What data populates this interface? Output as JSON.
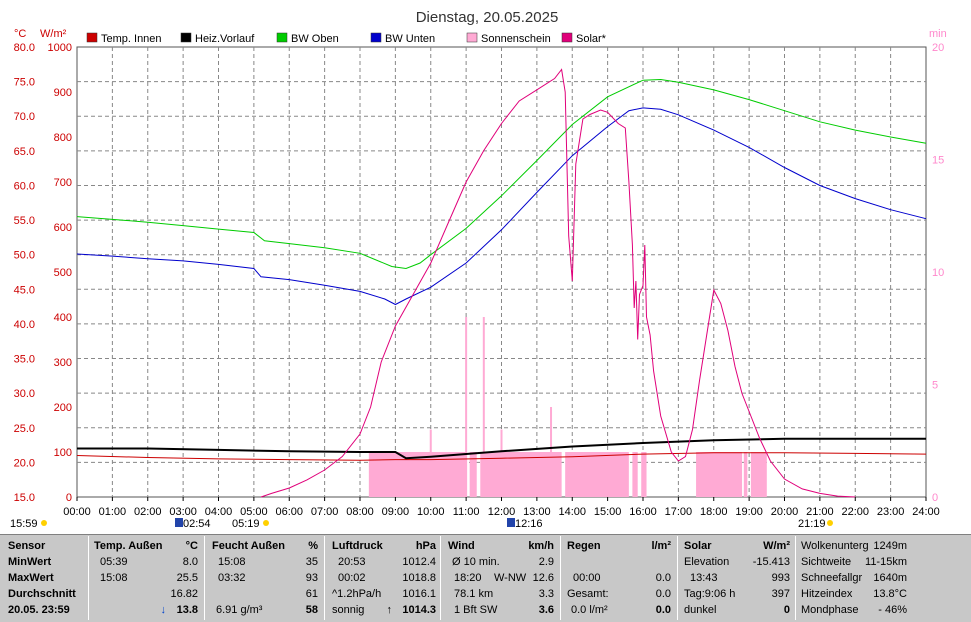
{
  "chart_data": {
    "type": "line",
    "title": "Dienstag, 20.05.2025",
    "axes": {
      "left1": {
        "unit": "°C",
        "min": 15,
        "max": 80,
        "ticks": [
          "80.0",
          "75.0",
          "70.0",
          "65.0",
          "60.0",
          "55.0",
          "50.0",
          "45.0",
          "40.0",
          "35.0",
          "30.0",
          "25.0",
          "20.0",
          "15.0"
        ],
        "color": "#cc0000"
      },
      "left2": {
        "unit": "W/m²",
        "min": 0,
        "max": 1000,
        "ticks": [
          "1000",
          "900",
          "800",
          "700",
          "600",
          "500",
          "400",
          "300",
          "200",
          "100",
          "0"
        ],
        "color": "#cc0000"
      },
      "right": {
        "unit": "min",
        "min": 0,
        "max": 20,
        "ticks": [
          "20",
          "15",
          "10",
          "5",
          "0"
        ],
        "color": "#ff88cc"
      },
      "x": {
        "ticks": [
          "00:00",
          "01:00",
          "02:00",
          "03:00",
          "04:00",
          "05:00",
          "06:00",
          "07:00",
          "08:00",
          "09:00",
          "10:00",
          "11:00",
          "12:00",
          "13:00",
          "14:00",
          "15:00",
          "16:00",
          "17:00",
          "18:00",
          "19:00",
          "20:00",
          "21:00",
          "22:00",
          "23:00",
          "24:00"
        ]
      }
    },
    "legend": [
      {
        "name": "Temp. Innen",
        "color": "#cc0000"
      },
      {
        "name": "Heiz.Vorlauf",
        "color": "#000000"
      },
      {
        "name": "BW Oben",
        "color": "#00cc00"
      },
      {
        "name": "BW Unten",
        "color": "#0000cc"
      },
      {
        "name": "Sonnenschein",
        "color": "#ffaad4"
      },
      {
        "name": "Solar*",
        "color": "#e0007a"
      }
    ],
    "series": [
      {
        "name": "Temp. Innen",
        "axis": "left1",
        "x": [
          0,
          2,
          4,
          6,
          8,
          9,
          10,
          12,
          14,
          16,
          18,
          20,
          22,
          24
        ],
        "y": [
          21.0,
          20.7,
          20.5,
          20.4,
          20.3,
          20.4,
          20.4,
          20.6,
          20.8,
          21.2,
          21.4,
          21.4,
          21.3,
          21.2
        ]
      },
      {
        "name": "Heiz.Vorlauf",
        "axis": "left1",
        "x": [
          0,
          2,
          4,
          6,
          8,
          9.0,
          9.3,
          10,
          12,
          14,
          16,
          18,
          20,
          22,
          24
        ],
        "y": [
          22.0,
          22.0,
          21.8,
          21.6,
          21.5,
          21.5,
          20.6,
          20.8,
          21.6,
          22.3,
          22.8,
          23.2,
          23.4,
          23.4,
          23.4
        ]
      },
      {
        "name": "BW Oben",
        "axis": "left1",
        "x": [
          0,
          1,
          2,
          3,
          4,
          5,
          5.3,
          6,
          7,
          8,
          8.9,
          9.3,
          9.7,
          10,
          11,
          12,
          13,
          14,
          15,
          16,
          16.5,
          17,
          18,
          19,
          20,
          21,
          22,
          23,
          24
        ],
        "y": [
          55.5,
          55.1,
          54.7,
          54.2,
          53.7,
          53.2,
          52.0,
          51.6,
          51.0,
          50.2,
          48.3,
          48.0,
          48.8,
          50.0,
          53.8,
          58.5,
          63.6,
          68.8,
          72.8,
          75.2,
          75.3,
          74.9,
          73.8,
          72.4,
          70.8,
          69.2,
          68.0,
          67.0,
          66.1
        ]
      },
      {
        "name": "BW Unten",
        "axis": "left1",
        "x": [
          0,
          1,
          2,
          3,
          4,
          5,
          5.2,
          6,
          7,
          8,
          8.7,
          9.0,
          9.3,
          10,
          11,
          12,
          13,
          14,
          15,
          15.6,
          16,
          16.5,
          17,
          18,
          19,
          20,
          21,
          22,
          23,
          24
        ],
        "y": [
          50.1,
          49.8,
          49.4,
          49.1,
          48.6,
          48.0,
          46.8,
          46.4,
          45.6,
          44.7,
          43.6,
          42.8,
          43.6,
          45.3,
          48.8,
          53.6,
          59.0,
          64.3,
          68.5,
          70.8,
          71.2,
          71.0,
          70.2,
          68.0,
          65.5,
          62.6,
          60.0,
          58.1,
          56.5,
          55.2
        ]
      },
      {
        "name": "Solar*",
        "axis": "left2",
        "x": [
          5.2,
          5.5,
          6,
          6.5,
          7,
          7.5,
          8,
          8.3,
          8.6,
          9,
          9.5,
          10,
          10.5,
          11,
          11.5,
          12,
          12.5,
          13,
          13.5,
          13.7,
          13.8,
          13.9,
          14.0,
          14.1,
          14.3,
          14.5,
          14.8,
          15.0,
          15.3,
          15.5,
          15.6,
          15.7,
          15.75,
          15.8,
          15.85,
          15.9,
          16.0,
          16.05,
          16.1,
          16.2,
          16.3,
          16.5,
          16.8,
          17.0,
          17.2,
          17.4,
          17.6,
          17.8,
          18.0,
          18.2,
          18.4,
          18.6,
          18.8,
          19.0,
          19.3,
          19.6,
          20.0,
          20.5,
          21.0,
          21.5,
          22.0
        ],
        "y": [
          0,
          8,
          20,
          38,
          60,
          90,
          140,
          200,
          300,
          380,
          450,
          520,
          610,
          700,
          770,
          830,
          880,
          905,
          930,
          950,
          900,
          580,
          480,
          740,
          840,
          850,
          860,
          855,
          830,
          820,
          700,
          560,
          420,
          480,
          350,
          450,
          470,
          560,
          400,
          360,
          280,
          180,
          100,
          80,
          90,
          150,
          260,
          360,
          460,
          430,
          370,
          290,
          230,
          190,
          130,
          80,
          40,
          18,
          8,
          2,
          0
        ]
      }
    ],
    "sunshine": {
      "name": "Sonnenschein",
      "axis": "right",
      "x": [
        8.25,
        9.0,
        10.0,
        11.0,
        12.0,
        13.0,
        14.0,
        15.0,
        15.6,
        15.9,
        16.0,
        16.1,
        17.5,
        18.0,
        18.8,
        19.0,
        19.5
      ],
      "y": [
        2,
        2,
        2,
        2,
        2,
        2,
        2,
        2,
        2,
        2,
        2,
        2,
        2,
        2,
        2,
        2,
        2
      ]
    },
    "sunshine_spans": [
      [
        8.25,
        11.0
      ],
      [
        11.1,
        11.3
      ],
      [
        11.4,
        13.7
      ],
      [
        13.8,
        15.6
      ],
      [
        15.7,
        15.85
      ],
      [
        15.95,
        16.1
      ],
      [
        17.5,
        18.8
      ],
      [
        18.85,
        18.95
      ],
      [
        19.05,
        19.5
      ]
    ],
    "sunshine_spikes": [
      [
        10.0,
        3
      ],
      [
        11.0,
        8
      ],
      [
        11.5,
        8
      ],
      [
        12.0,
        3
      ],
      [
        13.4,
        4
      ]
    ]
  },
  "time_markers": {
    "left": "15:59",
    "moonrise": "02:54",
    "sunrise": "05:19",
    "noon": "12:16",
    "sunset": "21:19"
  },
  "stats": {
    "sensor": {
      "h": "Sensor",
      "r1": "MinWert",
      "r2": "MaxWert",
      "r3": "Durchschnitt",
      "r4": "20.05. 23:59"
    },
    "temp": {
      "h": "Temp. Außen",
      "u": "°C",
      "r1t": "05:39",
      "r1v": "8.0",
      "r2t": "15:08",
      "r2v": "25.5",
      "r3v": "16.82",
      "r4v": "13.8",
      "trend": "↓"
    },
    "feucht": {
      "h": "Feucht Außen",
      "u": "%",
      "r1t": "15:08",
      "r1v": "35",
      "r2t": "03:32",
      "r2v": "93",
      "r3v": "61",
      "r4l": "6.91 g/m³",
      "r4v": "58"
    },
    "luft": {
      "h": "Luftdruck",
      "u": "hPa",
      "r1t": "20:53",
      "r1v": "1012.4",
      "r2t": "00:02",
      "r2v": "1018.8",
      "r3l": "^1.2hPa/h",
      "r3v": "1016.1",
      "r4l": "sonnig",
      "r4v": "1014.3",
      "trend": "↑"
    },
    "wind": {
      "h": "Wind",
      "u": "km/h",
      "r1l": "Ø 10 min.",
      "r1v": "2.9",
      "r2t": "18:20",
      "r2d": "W-NW",
      "r2v": "12.6",
      "r3l": "78.1 km",
      "r3v": "3.3",
      "r4l": "1 Bft SW",
      "r4v": "3.6"
    },
    "regen": {
      "h": "Regen",
      "u": "l/m²",
      "r2t": "00:00",
      "r2v": "0.0",
      "r3l": "Gesamt:",
      "r3v": "0.0",
      "r4l": "0.0 l/m²",
      "r4v": "0.0"
    },
    "solar": {
      "h": "Solar",
      "u": "W/m²",
      "r1l": "Elevation",
      "r1v": "-15.413",
      "r2t": "13:43",
      "r2v": "993",
      "r3l": "Tag:9:06 h",
      "r3v": "397",
      "r4l": "dunkel",
      "r4v": "0"
    },
    "misc": {
      "r0l": "Wolkenunterg",
      "r0v": "1249m",
      "r1l": "Sichtweite",
      "r1v": "11-15km",
      "r2l": "Schneefallgr",
      "r2v": "1640m",
      "r3l": "Hitzeindex",
      "r3v": "13.8°C",
      "r4l": "Mondphase",
      "r4v": "- 46%"
    }
  }
}
